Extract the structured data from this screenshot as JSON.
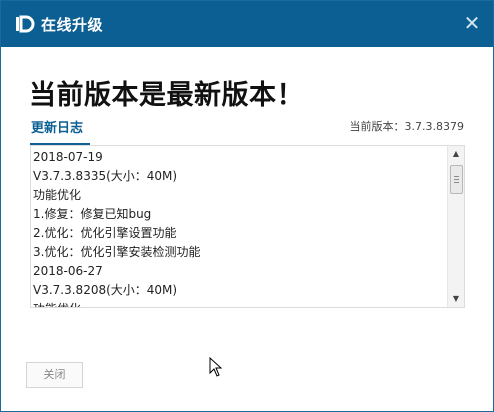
{
  "window": {
    "title": "在线升级"
  },
  "headline": "当前版本是最新版本！",
  "tabs": {
    "changelog": "更新日志"
  },
  "current_version": "当前版本：3.7.3.8379",
  "changelog_lines": [
    "2018-07-19",
    "V3.7.3.8335(大小：40M)",
    "功能优化",
    "1.修复：修复已知bug",
    "2.优化：优化引擎设置功能",
    "3.优化：优化引擎安装检测功能",
    "2018-06-27",
    "V3.7.3.8208(大小：40M)",
    "功能优化"
  ],
  "footer": {
    "close_label": "关闭"
  },
  "icons": {
    "app": "app-logo-icon",
    "close": "close-icon",
    "scroll_up": "scroll-up-arrow-icon",
    "scroll_down": "scroll-down-arrow-icon",
    "cursor": "mouse-cursor-icon"
  },
  "colors": {
    "titlebar": "#0c5f93",
    "accent": "#0c5f93"
  }
}
